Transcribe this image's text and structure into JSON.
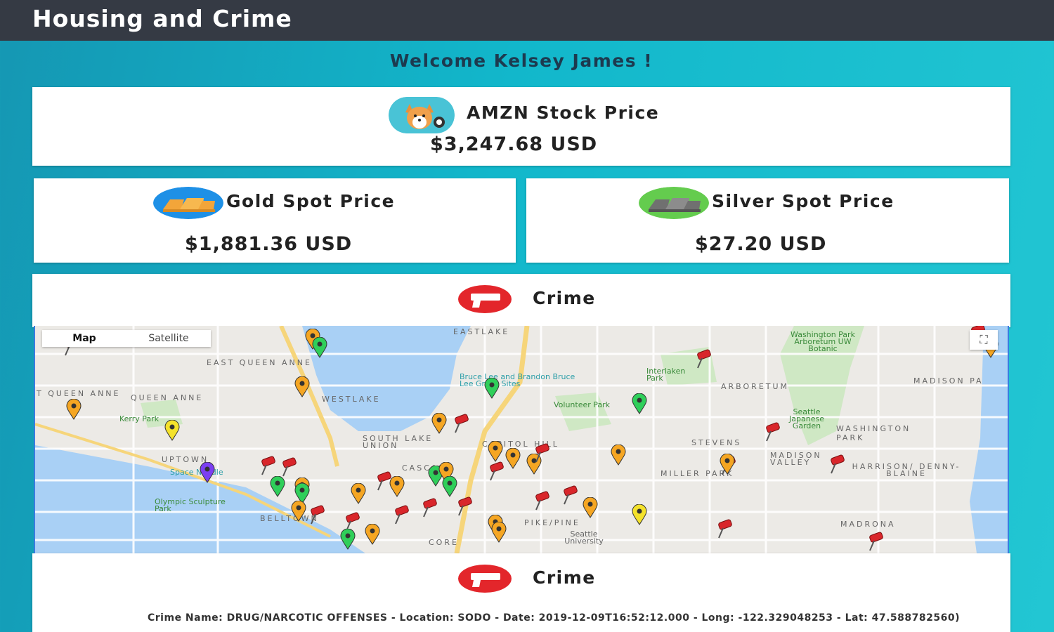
{
  "app": {
    "title": "Housing and Crime"
  },
  "welcome": "Welcome Kelsey James !",
  "amzn": {
    "title": "AMZN Stock Price",
    "price": "$3,247.68 USD",
    "icon": "corgi-avatar-icon"
  },
  "gold": {
    "title": "Gold Spot Price",
    "price": "$1,881.36 USD",
    "icon": "gold-bars-icon"
  },
  "silver": {
    "title": "Silver Spot Price",
    "price": "$27.20 USD",
    "icon": "silver-bars-icon"
  },
  "crime_header": {
    "title": "Crime",
    "icon": "gun-icon"
  },
  "map": {
    "toggle": {
      "map": "Map",
      "satellite": "Satellite"
    },
    "labels": {
      "eastlake": "EASTLAKE",
      "east_queen_anne": "EAST QUEEN ANNE",
      "queen_anne": "QUEEN ANNE",
      "t_queen_anne": "T QUEEN ANNE",
      "kerry_park": "Kerry Park",
      "uptown": "UPTOWN",
      "space_needle": "Space Needle",
      "olympic_park": "Olympic Sculpture Park",
      "belltown": "BELLTOWN",
      "south_lake_union": "SOUTH LAKE UNION",
      "cascade": "CASCADE",
      "capitol_hill": "CAPITOL HILL",
      "pike_pine": "PIKE/PINE",
      "core": "CORE",
      "volunteer_park": "Volunteer Park",
      "bruce_lee": "Bruce Lee and Brandon Bruce Lee Grave Sites",
      "interlaken": "Interlaken Park",
      "arboretum": "ARBORETUM",
      "washington_park": "WASHINGTON PARK",
      "washington_park_arboretum": "Washington Park Arboretum UW Botanic",
      "japanese_garden": "Seattle Japanese Garden",
      "stevens": "STEVENS",
      "madison_valley": "MADISON VALLEY",
      "miller_park": "MILLER PARK",
      "harrison": "HARRISON/ DENNY-BLAINE",
      "madrona": "MADRONA",
      "madison_pa": "MADISON PA",
      "seattle_university": "Seattle University",
      "westlake": "WESTLAKE"
    }
  },
  "crime_detail": {
    "title": "Crime",
    "text": "Crime Name: DRUG/NARCOTIC OFFENSES - Location: SODO - Date: 2019-12-09T16:52:12.000 - Long: -122.329048253 - Lat: 47.588782560)"
  },
  "colors": {
    "topbar": "#353a44",
    "pin_red": "#d9262b",
    "pin_orange": "#f5a623",
    "pin_green": "#2fcf5a",
    "pin_yellow": "#f4e22b",
    "pin_purple": "#7b3ff2"
  }
}
